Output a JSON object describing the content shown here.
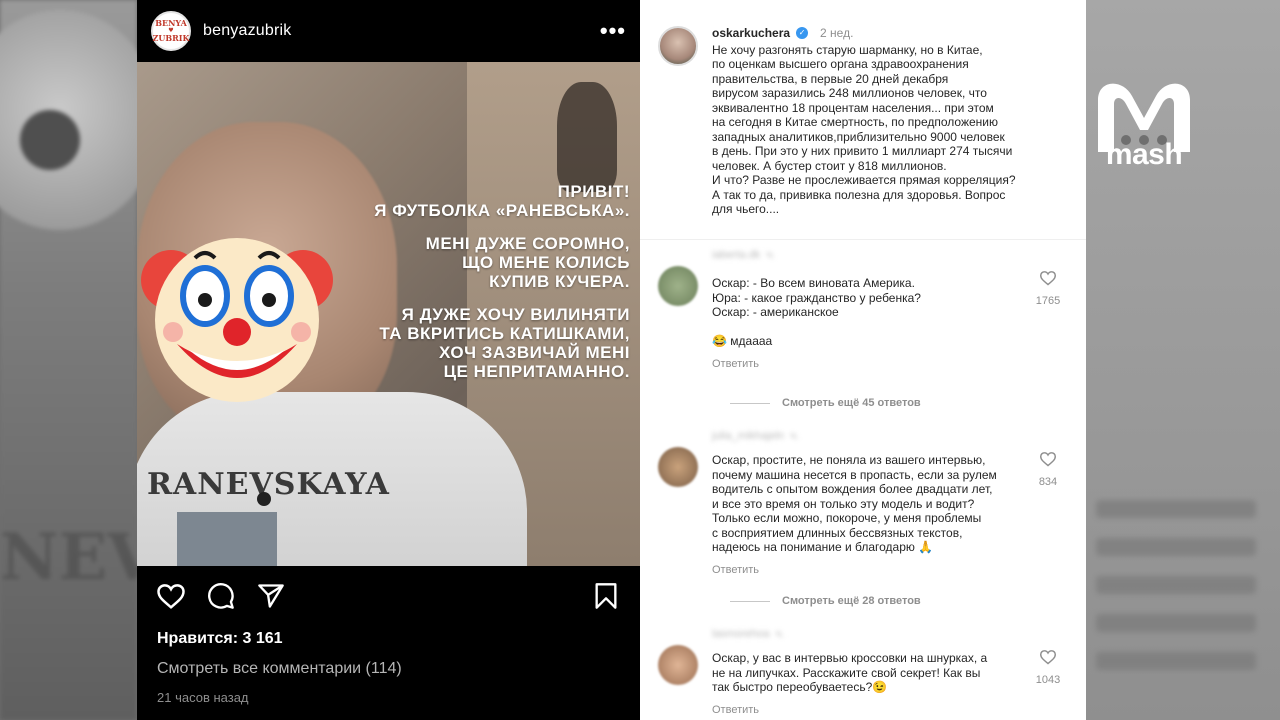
{
  "overlay": {
    "brand": "mash"
  },
  "post": {
    "username": "benyazubrik",
    "avatar_text": [
      "BENYA",
      "♥",
      "ZUBRIK"
    ],
    "more_glyph": "•••",
    "image": {
      "caption_lines": [
        "ПРИВІТ!\nЯ ФУТБОЛКА «РАНЕВСЬКА».",
        "МЕНІ ДУЖЕ СОРОМНО,\nЩО МЕНЕ КОЛИСЬ\nКУПИВ КУЧЕРА.",
        "Я ДУЖЕ ХОЧУ ВИЛИНЯТИ\nТА ВКРИТИСЬ КАТИШКАМИ,\nХОЧ ЗАЗВИЧАЙ МЕНІ\nЦЕ НЕПРИТАМАННО."
      ],
      "shirt_print": "RANEVSKAYA"
    },
    "likes": "Нравится: 3 161",
    "view_comments": "Смотреть все комментарии (114)",
    "timestamp": "21 часов назад"
  },
  "caption": {
    "username": "oskarkuchera",
    "age": "2 нед.",
    "text": "Не хочу разгонять старую шарманку, но в Китае,\nпо оценкам высшего органа здравоохранения\nправительства, в первые 20 дней декабря\nвирусом заразились 248 миллионов человек, что\nэквивалентно 18 процентам населения... при этом\nна сегодня в Китае смертность, по предположению\nзападных аналитиков,приблизительно 9000 человек\nв день. При это у них привито 1 миллиарт 274 тысячи\nчеловек. А бустер стоит у 818 миллионов.\nИ что? Разве не прослеживается прямая корреляция?\nА так то да, прививка полезна для здоровья. Вопрос\nдля чьего...."
  },
  "comments": [
    {
      "user": "iaberta.dk",
      "age": "ч.",
      "text": "Оскар: - Во всем виновата Америка.\nЮра: - какое гражданство у ребенка?\nОскар: - американское\n\n😂 мдаааа",
      "likes": "1765",
      "reply": "Ответить",
      "more": "Смотреть ещё 45 ответов"
    },
    {
      "user": "julia_mikhajeln",
      "age": "ч.",
      "text": "Оскар, простите, не поняла из вашего интервью,\nпочему машина несется в пропасть, если за рулем\nводитель с опытом вождения более двадцати лет,\nи все это время он только эту модель и водит?\nТолько если можно, покороче, у меня проблемы\nс восприятием длинных бессвязных текстов,\nнадеюсь на понимание и благодарю 🙏",
      "likes": "834",
      "reply": "Ответить",
      "more": "Смотреть ещё 28 ответов"
    },
    {
      "user": "lasmorehoa",
      "age": "ч.",
      "text": "Оскар, у вас в интервью кроссовки на шнурках, а\nне на липучках. Расскажите свой секрет! Как вы\nтак быстро переобуваетесь?😉",
      "likes": "1043",
      "reply": "Ответить"
    }
  ],
  "colors": {
    "post_bg": "#000000",
    "panel_bg": "#ffffff",
    "muted": "#8e8e8e",
    "verified": "#3897f0"
  },
  "icons": [
    "heart-icon",
    "comment-icon",
    "share-icon",
    "bookmark-icon",
    "more-icon",
    "verified-icon"
  ]
}
